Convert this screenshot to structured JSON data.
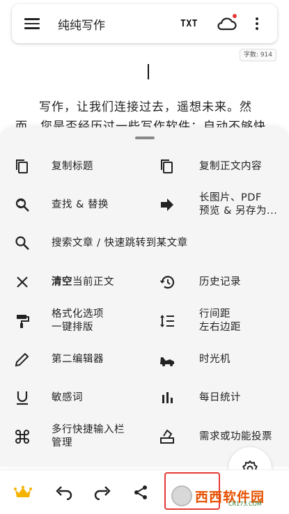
{
  "appbar": {
    "title": "纯纯写作",
    "txt_label": "TXT"
  },
  "wordcount": "字数: 914",
  "editor": {
    "line1": "写作，让我们连接过去，遥想未来。然",
    "line2": "而，您是否经历过一些写作软件：自动不够快"
  },
  "sheet": {
    "items": [
      {
        "label": "复制标题",
        "icon": "copy-icon"
      },
      {
        "label": "复制正文内容",
        "icon": "copy-icon"
      },
      {
        "label": "查找 & 替换",
        "icon": "find-replace-icon"
      },
      {
        "label_line1": "长图片、PDF",
        "label_line2": "预览 & 另存为...",
        "icon": "arrow-right-icon"
      },
      {
        "label": "搜索文章 / 快速跳转到某文章",
        "icon": "search-icon"
      },
      {
        "label_bold": "清空",
        "label_rest": "当前正文",
        "icon": "close-icon"
      },
      {
        "label": "历史记录",
        "icon": "history-icon"
      },
      {
        "label_line1": "格式化选项",
        "label_line2": "一键排版",
        "icon": "format-paint-icon"
      },
      {
        "label_line1": "行间距",
        "label_line2": "左右边距",
        "icon": "line-spacing-icon"
      },
      {
        "label": "第二编辑器",
        "icon": "pencil-icon"
      },
      {
        "label": "时光机",
        "icon": "time-machine-icon"
      },
      {
        "label": "敏感词",
        "icon": "underline-icon"
      },
      {
        "label": "每日统计",
        "icon": "bar-chart-icon"
      },
      {
        "label_line1": "多行快捷输入栏",
        "label_line2": "管理",
        "icon": "command-icon"
      },
      {
        "label": "需求或功能投票",
        "icon": "vote-icon"
      }
    ]
  },
  "watermark": {
    "main": "西西软件园",
    "sub": "CR173.COM"
  },
  "colors": {
    "accent_red": "#e53935",
    "sheet_bg": "#f5f5f5",
    "crown": "#f5b301"
  }
}
